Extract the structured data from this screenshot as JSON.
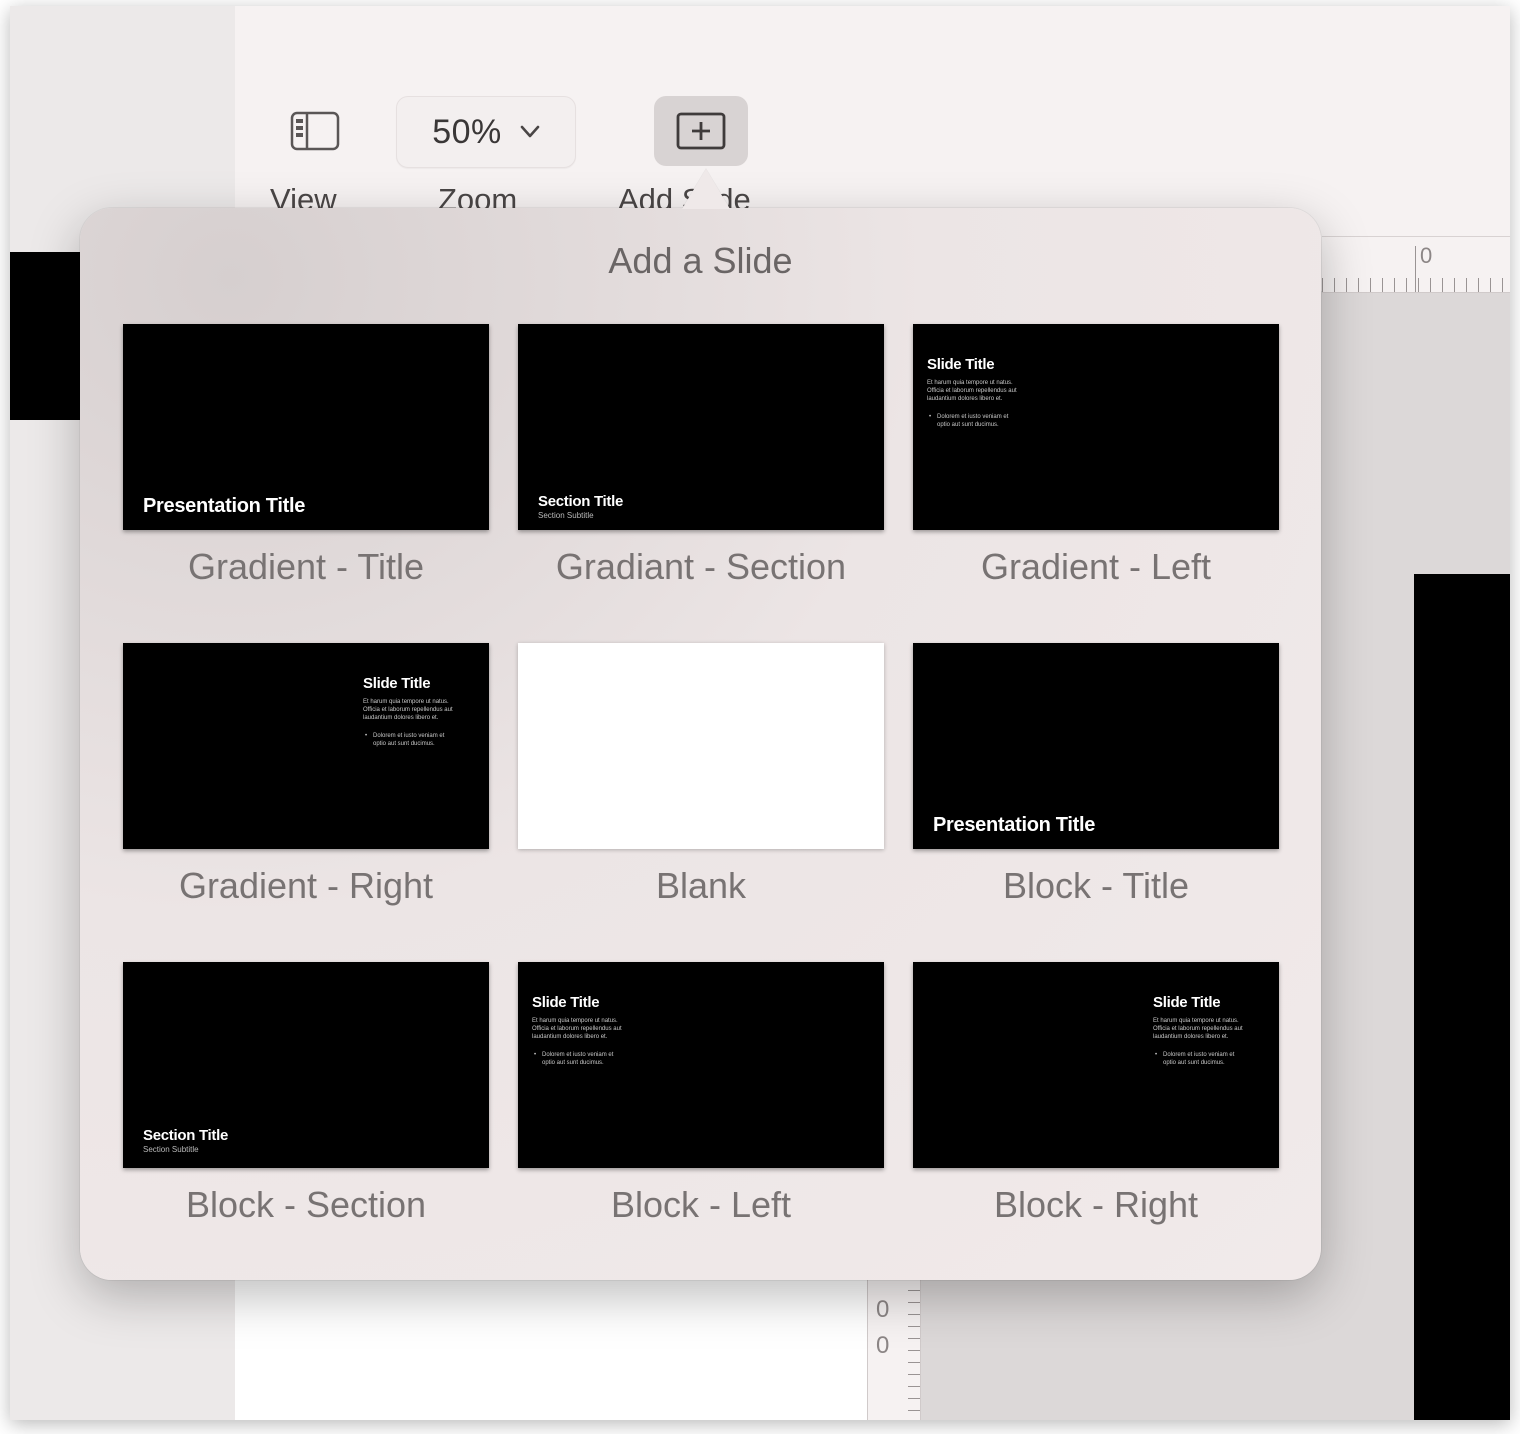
{
  "toolbar": {
    "view_label": "View",
    "zoom_value": "50%",
    "zoom_label": "Zoom",
    "add_slide_label": "Add Slide"
  },
  "rulers": {
    "horizontal_value": "0",
    "vertical_values": [
      "0",
      "0"
    ]
  },
  "popover": {
    "title": "Add a Slide",
    "layouts": [
      {
        "name": "Gradient - Title",
        "preview": "title",
        "thumb_text": "Presentation Title"
      },
      {
        "name": "Gradiant - Section",
        "preview": "section",
        "thumb_text": "Section Title",
        "thumb_subtext": "Section Subtitle"
      },
      {
        "name": "Gradient - Left",
        "preview": "content-left",
        "thumb_text": "Slide Title",
        "thumb_body": "Et harum quia tempore ut natus. Officia et laborum repellendus aut laudantium dolores libero et.",
        "thumb_bullet": "Dolorem et iusto veniam et optio aut sunt ducimus."
      },
      {
        "name": "Gradient - Right",
        "preview": "content-right",
        "thumb_text": "Slide Title",
        "thumb_body": "Et harum quia tempore ut natus. Officia et laborum repellendus aut laudantium dolores libero et.",
        "thumb_bullet": "Dolorem et iusto veniam et optio aut sunt ducimus."
      },
      {
        "name": "Blank",
        "preview": "blank"
      },
      {
        "name": "Block - Title",
        "preview": "title",
        "thumb_text": "Presentation Title"
      },
      {
        "name": "Block - Section",
        "preview": "section",
        "thumb_text": "Section Title",
        "thumb_subtext": "Section Subtitle"
      },
      {
        "name": "Block - Left",
        "preview": "content-left",
        "thumb_text": "Slide Title",
        "thumb_body": "Et harum quia tempore ut natus. Officia et laborum repellendus aut laudantium dolores libero et.",
        "thumb_bullet": "Dolorem et iusto veniam et optio aut sunt ducimus."
      },
      {
        "name": "Block - Right",
        "preview": "content-right",
        "thumb_text": "Slide Title",
        "thumb_body": "Et harum quia tempore ut natus. Officia et laborum repellendus aut laudantium dolores libero et.",
        "thumb_bullet": "Dolorem et iusto veniam et optio aut sunt ducimus."
      }
    ]
  },
  "colors": {
    "thumb_background": "#000000",
    "blank_background": "#ffffff",
    "popover_background": "#f1eaea",
    "label_text": "#787373"
  }
}
